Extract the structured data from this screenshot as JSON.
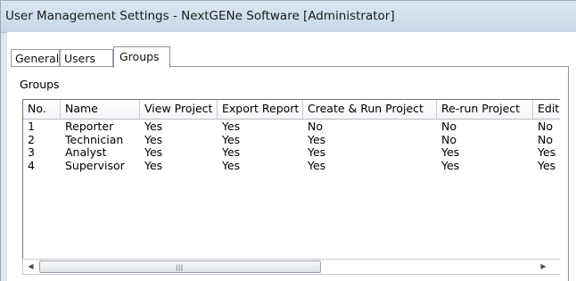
{
  "window": {
    "title": "User Management Settings - NextGENe Software [Administrator]"
  },
  "tabs": [
    {
      "label": "General",
      "active": false
    },
    {
      "label": "Users",
      "active": false
    },
    {
      "label": "Groups",
      "active": true
    }
  ],
  "groups_panel": {
    "section_label": "Groups",
    "columns": [
      "No.",
      "Name",
      "View Project",
      "Export Report",
      "Create & Run Project",
      "Re-run Project",
      "Edit"
    ],
    "rows": [
      [
        "1",
        "Reporter",
        "Yes",
        "Yes",
        "No",
        "No",
        "No"
      ],
      [
        "2",
        "Technician",
        "Yes",
        "Yes",
        "Yes",
        "No",
        "No"
      ],
      [
        "3",
        "Analyst",
        "Yes",
        "Yes",
        "Yes",
        "Yes",
        "Yes"
      ],
      [
        "4",
        "Supervisor",
        "Yes",
        "Yes",
        "Yes",
        "Yes",
        "Yes"
      ]
    ]
  },
  "scrollbar": {
    "left_arrow": "◀",
    "right_arrow": "▶",
    "grip": "|||"
  }
}
